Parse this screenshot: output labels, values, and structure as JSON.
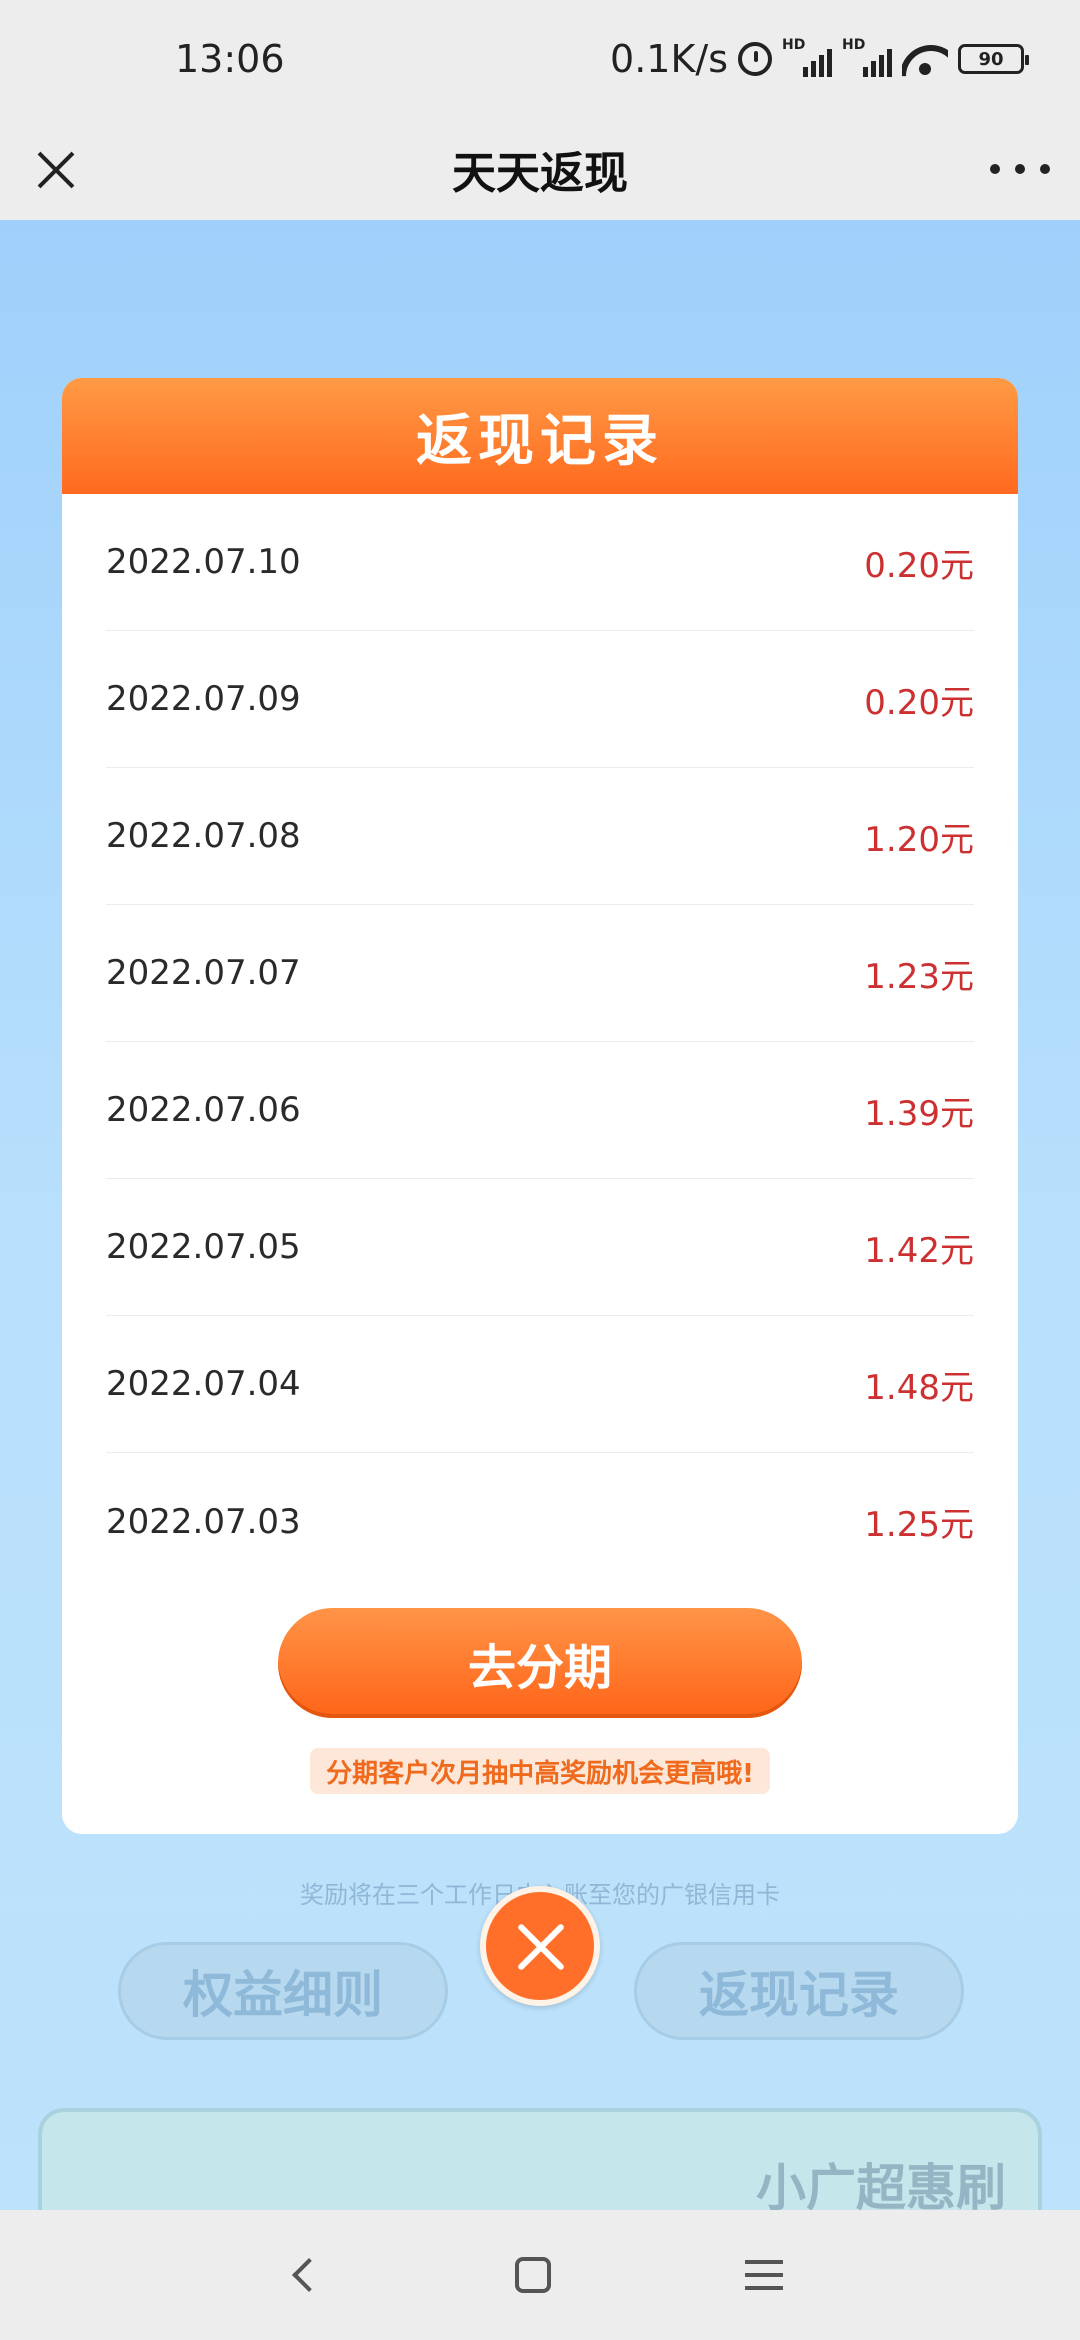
{
  "status_bar": {
    "time": "13:06",
    "net_speed": "0.1K/s",
    "battery": "90"
  },
  "title_bar": {
    "title": "天天返现"
  },
  "background": {
    "hint": "奖励将在三个工作日内入账至您的广银信用卡",
    "btn_left": "权益细则",
    "btn_right": "返现记录",
    "card_text": "小广超惠刷"
  },
  "modal": {
    "title": "返现记录",
    "records": [
      {
        "date": "2022.07.10",
        "amount": "0.20元"
      },
      {
        "date": "2022.07.09",
        "amount": "0.20元"
      },
      {
        "date": "2022.07.08",
        "amount": "1.20元"
      },
      {
        "date": "2022.07.07",
        "amount": "1.23元"
      },
      {
        "date": "2022.07.06",
        "amount": "1.39元"
      },
      {
        "date": "2022.07.05",
        "amount": "1.42元"
      },
      {
        "date": "2022.07.04",
        "amount": "1.48元"
      },
      {
        "date": "2022.07.03",
        "amount": "1.25元"
      }
    ],
    "button_label": "去分期",
    "promo": "分期客户次月抽中高奖励机会更高哦!"
  },
  "colors": {
    "accent": "#ff6a1f",
    "amount": "#cc3030"
  }
}
